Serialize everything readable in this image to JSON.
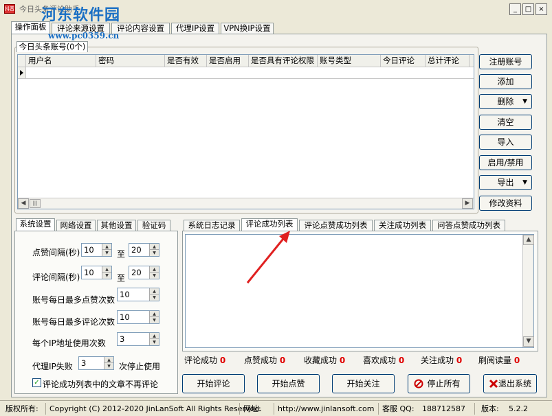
{
  "window": {
    "icon_text": "抖音",
    "title": "今日头条评论助手",
    "watermark_title": "河东软件园",
    "watermark_url": "www.pc0359.cn",
    "btn_min": "_",
    "btn_max": "□",
    "btn_close": "×"
  },
  "main_tabs": [
    "操作面板",
    "评论来源设置",
    "评论内容设置",
    "代理IP设置",
    "VPN换IP设置"
  ],
  "accounts": {
    "tab_label": "今日头条账号(0个)",
    "columns": [
      "用户名",
      "密码",
      "是否有效",
      "是否启用",
      "是否具有评论权限",
      "账号类型",
      "今日评论",
      "总计评论"
    ],
    "scroll_left": "◀",
    "scroll_right": "▶",
    "buttons": {
      "register": "注册账号",
      "add": "添加",
      "delete": "删除",
      "clear": "清空",
      "import": "导入",
      "toggle": "启用/禁用",
      "export": "导出",
      "edit": "修改资料"
    },
    "dropdown_arrow": "▼"
  },
  "settings_tabs": [
    "系统设置",
    "网络设置",
    "其他设置",
    "验证码"
  ],
  "settings": {
    "like_interval_label": "点赞间隔(秒)",
    "like_min": "10",
    "like_max": "20",
    "comment_interval_label": "评论间隔(秒)",
    "comment_min": "10",
    "comment_max": "20",
    "to_label": "至",
    "daily_like_label": "账号每日最多点赞次数",
    "daily_like": "10",
    "daily_comment_label": "账号每日最多评论次数",
    "daily_comment": "10",
    "ip_use_label": "每个IP地址使用次数",
    "ip_use": "3",
    "proxy_fail_label": "代理IP失败",
    "proxy_fail": "3",
    "proxy_fail_suffix": "次停止使用",
    "checkbox_label": "评论成功列表中的文章不再评论",
    "checkbox_mark": "✓"
  },
  "log_tabs": [
    "系统日志记录",
    "评论成功列表",
    "评论点赞成功列表",
    "关注成功列表",
    "问答点赞成功列表"
  ],
  "log_scroll_up": "▲",
  "log_scroll_down": "▼",
  "stats": [
    {
      "label": "评论成功",
      "value": "0"
    },
    {
      "label": "点赞成功",
      "value": "0"
    },
    {
      "label": "收藏成功",
      "value": "0"
    },
    {
      "label": "喜欢成功",
      "value": "0"
    },
    {
      "label": "关注成功",
      "value": "0"
    },
    {
      "label": "刷阅读量",
      "value": "0"
    }
  ],
  "actions": {
    "start_comment": "开始评论",
    "start_like": "开始点赞",
    "start_follow": "开始关注",
    "stop_all": "停止所有",
    "exit": "退出系统"
  },
  "statusbar": {
    "copyright_label": "版权所有:",
    "copyright": "Copyright (C) 2012-2020 JinLanSoft All Rights Reserved.",
    "site_label": "网址:",
    "site": "http://www.jinlansoft.com",
    "qq_label": "客服 QQ:",
    "qq": "188712587",
    "version_label": "版本:",
    "version": "5.2.2"
  },
  "colors": {
    "stat_value": "#e00000",
    "annotation_arrow": "#e02020",
    "watermark": "#1a6fc4"
  }
}
